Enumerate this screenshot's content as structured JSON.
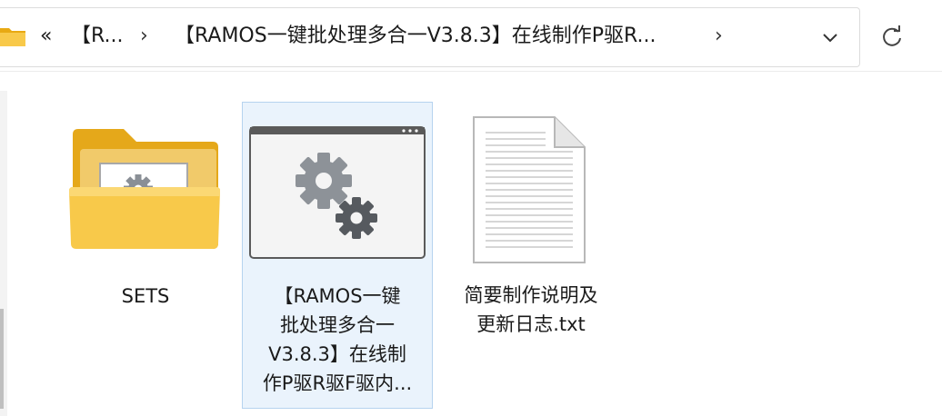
{
  "address_bar": {
    "overflow_label": "«",
    "crumb1": "【R...",
    "crumb2": "【RAMOS一键批处理多合一V3.8.3】在线制作P驱R...",
    "separator": "›"
  },
  "items": [
    {
      "name_line1": "SETS"
    },
    {
      "name_line1": "【RAMOS一键",
      "name_line2": "批处理多合一",
      "name_line3": "V3.8.3】在线制",
      "name_line4": "作P驱R驱F驱内..."
    },
    {
      "name_line1": "简要制作说明及",
      "name_line2": "更新日志.txt"
    }
  ],
  "colors": {
    "folder_yellow": "#f5c443",
    "selection_bg": "#eaf3fc",
    "selection_border": "#b6d3ef"
  },
  "icons": [
    "folder-icon",
    "chevron-right-icon",
    "chevron-down-icon",
    "refresh-icon",
    "folder-gear-icon",
    "app-gear-icon",
    "text-file-icon"
  ]
}
